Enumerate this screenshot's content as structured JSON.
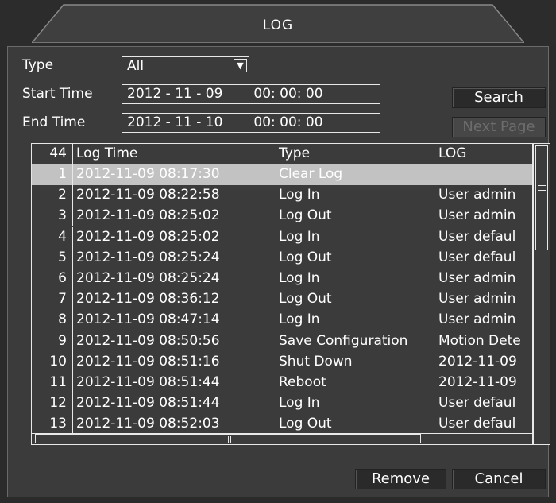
{
  "window": {
    "title": "LOG"
  },
  "filters": {
    "type_label": "Type",
    "type_value": "All",
    "start_label": "Start Time",
    "start_date": "2012 - 11 - 09",
    "start_time": "00: 00: 00",
    "end_label": "End Time",
    "end_date": "2012 - 11 - 10",
    "end_time": "00: 00: 00"
  },
  "buttons": {
    "search": "Search",
    "next_page": "Next Page",
    "remove": "Remove",
    "cancel": "Cancel"
  },
  "table": {
    "count": "44",
    "headers": {
      "time": "Log Time",
      "type": "Type",
      "log": "LOG"
    },
    "selected_index": 0,
    "rows": [
      {
        "num": "1",
        "time": "2012-11-09 08:17:30",
        "type": "Clear Log",
        "log": ""
      },
      {
        "num": "2",
        "time": "2012-11-09 08:22:58",
        "type": "Log In",
        "log": "User admin"
      },
      {
        "num": "3",
        "time": "2012-11-09 08:25:02",
        "type": "Log Out",
        "log": "User admin"
      },
      {
        "num": "4",
        "time": "2012-11-09 08:25:02",
        "type": "Log In",
        "log": "User defaul"
      },
      {
        "num": "5",
        "time": "2012-11-09 08:25:24",
        "type": "Log Out",
        "log": "User defaul"
      },
      {
        "num": "6",
        "time": "2012-11-09 08:25:24",
        "type": "Log In",
        "log": "User admin"
      },
      {
        "num": "7",
        "time": "2012-11-09 08:36:12",
        "type": "Log Out",
        "log": "User admin"
      },
      {
        "num": "8",
        "time": "2012-11-09 08:47:14",
        "type": "Log In",
        "log": "User admin"
      },
      {
        "num": "9",
        "time": "2012-11-09 08:50:56",
        "type": "Save Configuration",
        "log": "Motion Dete"
      },
      {
        "num": "10",
        "time": "2012-11-09 08:51:16",
        "type": "Shut Down",
        "log": "2012-11-09"
      },
      {
        "num": "11",
        "time": "2012-11-09 08:51:44",
        "type": "Reboot",
        "log": "2012-11-09"
      },
      {
        "num": "12",
        "time": "2012-11-09 08:51:44",
        "type": "Log In",
        "log": "User defaul"
      },
      {
        "num": "13",
        "time": "2012-11-09 08:52:03",
        "type": "Log Out",
        "log": "User defaul"
      }
    ]
  }
}
